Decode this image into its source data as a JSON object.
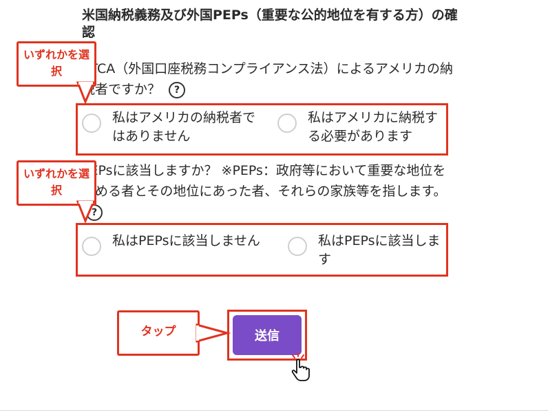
{
  "section": {
    "heading": "米国納税義務及び外国PEPs（重要な公的地位を有する方）の確認"
  },
  "fatca": {
    "question": "ATCA（外国口座税務コンプライアンス法）によるアメリカの納税者ですか？",
    "help_label": "?",
    "options": [
      {
        "label": "私はアメリカの納税者ではありません"
      },
      {
        "label": "私はアメリカに納税する必要があります"
      }
    ]
  },
  "peps": {
    "question": "PEPsに該当しますか？ ※PEPs：政府等において重要な地位を占める者とその地位にあった者、それらの家族等を指します。",
    "help_label": "?",
    "options": [
      {
        "label": "私はPEPsに該当しません"
      },
      {
        "label": "私はPEPsに該当します"
      }
    ]
  },
  "annotations": {
    "select_one": "いずれかを選択",
    "tap": "タップ"
  },
  "submit": {
    "label": "送信"
  },
  "colors": {
    "annotation_red": "#e0331f",
    "button_purple": "#7b4cc7"
  }
}
